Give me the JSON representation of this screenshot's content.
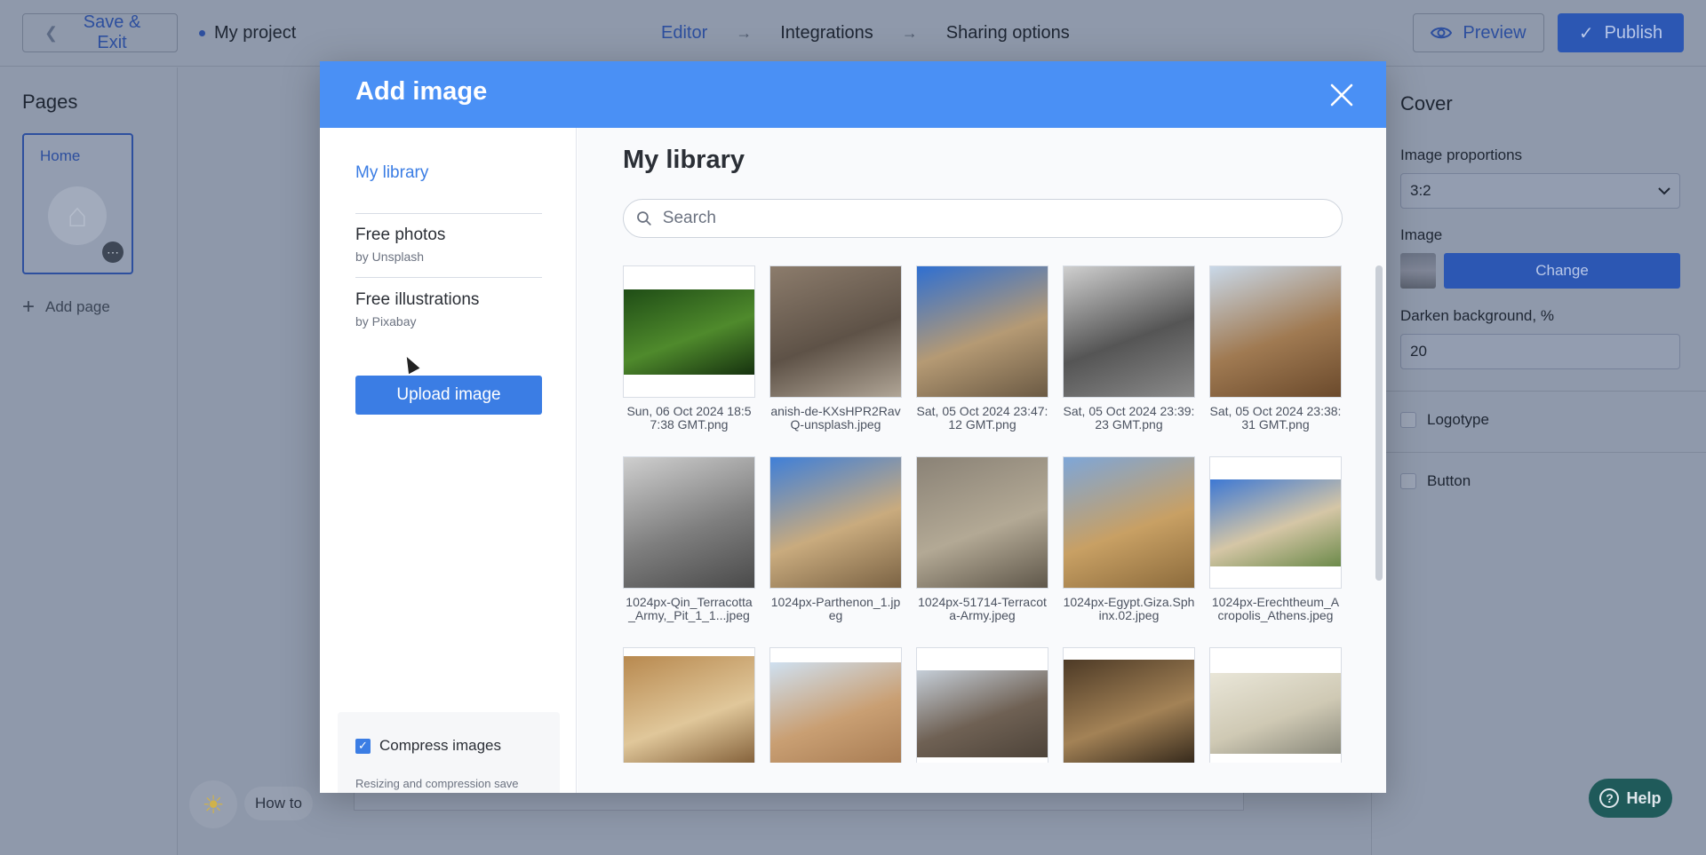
{
  "topbar": {
    "save_exit": "Save & Exit",
    "project_name": "My project",
    "steps": [
      "Editor",
      "Integrations",
      "Sharing options"
    ],
    "preview": "Preview",
    "publish": "Publish"
  },
  "pages": {
    "title": "Pages",
    "home": "Home",
    "add_page": "Add page"
  },
  "settings": {
    "title": "Cover",
    "proportions_label": "Image proportions",
    "proportions_value": "3:2",
    "image_label": "Image",
    "change": "Change",
    "darken_label": "Darken background, %",
    "darken_value": "20",
    "logotype": "Logotype",
    "button": "Button"
  },
  "footer": {
    "how_to": "How to",
    "help": "Help"
  },
  "modal": {
    "title": "Add image",
    "sidebar": {
      "my_library": "My library",
      "free_photos": "Free photos",
      "free_photos_sub": "by Unsplash",
      "free_illustrations": "Free illustrations",
      "free_illustrations_sub": "by Pixabay",
      "upload": "Upload image",
      "compress": "Compress images",
      "compress_note": "Resizing and compression save storage space and increase content loading speed."
    },
    "library_title": "My library",
    "search_placeholder": "Search",
    "images": [
      {
        "caption": "Sun, 06 Oct 2024 18:57:38 GMT.png",
        "colors": [
          "#1f4d16",
          "#4f8a2c",
          "#16320f"
        ],
        "ratio": 0.65
      },
      {
        "caption": "anish-de-KXsHPR2RavQ-unsplash.jpeg",
        "colors": [
          "#8c7c6c",
          "#5e5247",
          "#b0a596"
        ],
        "ratio": 1.0
      },
      {
        "caption": "Sat, 05 Oct 2024 23:47:12 GMT.png",
        "colors": [
          "#2f6fd1",
          "#b59a74",
          "#6b5a44"
        ],
        "ratio": 1.0
      },
      {
        "caption": "Sat, 05 Oct 2024 23:39:23 GMT.png",
        "colors": [
          "#cfcfcf",
          "#555555",
          "#8a8a8a"
        ],
        "ratio": 1.0
      },
      {
        "caption": "Sat, 05 Oct 2024 23:38:31 GMT.png",
        "colors": [
          "#c9d8e8",
          "#a07a52",
          "#6b4a2c"
        ],
        "ratio": 1.0
      },
      {
        "caption": "1024px-Qin_Terracotta_Army,_Pit_1_1...jpeg",
        "colors": [
          "#cfcfcf",
          "#7e7e7e",
          "#4a4a4a"
        ],
        "ratio": 1.0
      },
      {
        "caption": "1024px-Parthenon_1.jpeg",
        "colors": [
          "#3f7fd8",
          "#c9ab7e",
          "#7b6344"
        ],
        "ratio": 1.0
      },
      {
        "caption": "1024px-51714-Terracota-Army.jpeg",
        "colors": [
          "#8a8276",
          "#b3a995",
          "#5f574a"
        ],
        "ratio": 1.0
      },
      {
        "caption": "1024px-Egypt.Giza.Sphinx.02.jpeg",
        "colors": [
          "#7ea6d8",
          "#c8a064",
          "#8c6b3c"
        ],
        "ratio": 1.0
      },
      {
        "caption": "1024px-Erechtheum_Acropolis_Athens.jpeg",
        "colors": [
          "#3d78d4",
          "#d5c6a6",
          "#6c8a4a"
        ],
        "ratio": 0.67
      },
      {
        "caption": "",
        "colors": [
          "#b8894f",
          "#e0c79a",
          "#7a5630"
        ],
        "ratio": 0.88
      },
      {
        "caption": "",
        "colors": [
          "#cfe0f0",
          "#c99f73",
          "#a87c53"
        ],
        "ratio": 0.78
      },
      {
        "caption": "",
        "colors": [
          "#c5ced8",
          "#6f6154",
          "#4d4339"
        ],
        "ratio": 0.67
      },
      {
        "caption": "",
        "colors": [
          "#4d3a26",
          "#a38256",
          "#2f2418"
        ],
        "ratio": 0.82
      },
      {
        "caption": "",
        "colors": [
          "#e9e6d8",
          "#cfc9b4",
          "#8b8a7c"
        ],
        "ratio": 0.62
      }
    ]
  }
}
